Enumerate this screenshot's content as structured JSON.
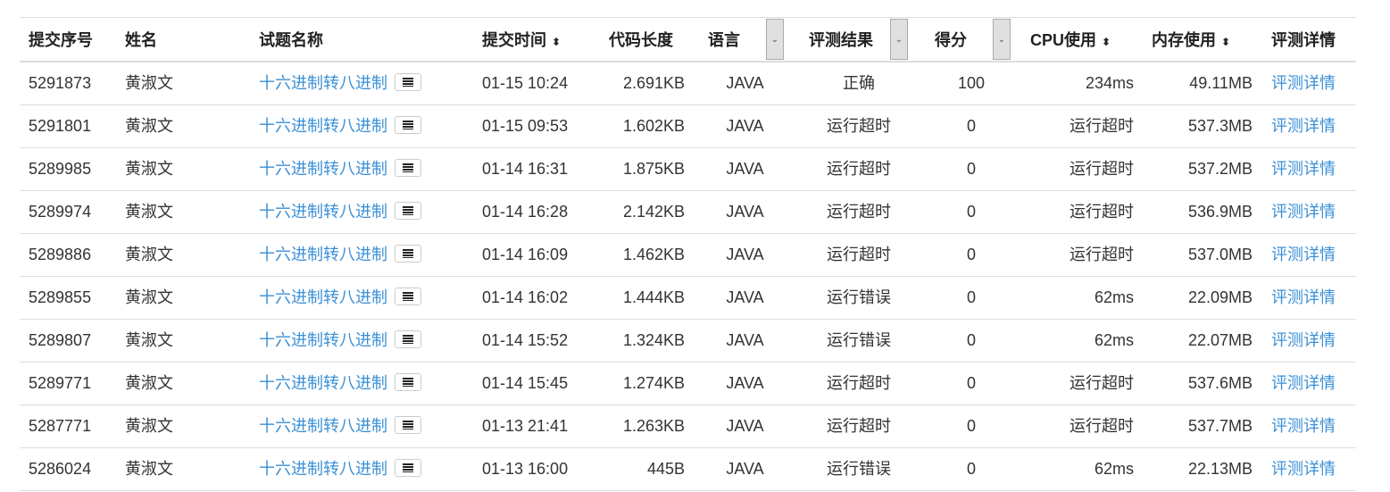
{
  "headers": {
    "id": "提交序号",
    "name": "姓名",
    "problem": "试题名称",
    "time": "提交时间",
    "length": "代码长度",
    "lang": "语言",
    "result": "评测结果",
    "score": "得分",
    "cpu": "CPU使用",
    "mem": "内存使用",
    "detail": "评测详情"
  },
  "sort_icon": "⬍",
  "dropdown_icon": "⌄",
  "rows": [
    {
      "id": "5291873",
      "name": "黄淑文",
      "problem": "十六进制转八进制",
      "time": "01-15 10:24",
      "length": "2.691KB",
      "lang": "JAVA",
      "result": "正确",
      "score": "100",
      "cpu": "234ms",
      "mem": "49.11MB",
      "detail": "评测详情"
    },
    {
      "id": "5291801",
      "name": "黄淑文",
      "problem": "十六进制转八进制",
      "time": "01-15 09:53",
      "length": "1.602KB",
      "lang": "JAVA",
      "result": "运行超时",
      "score": "0",
      "cpu": "运行超时",
      "mem": "537.3MB",
      "detail": "评测详情"
    },
    {
      "id": "5289985",
      "name": "黄淑文",
      "problem": "十六进制转八进制",
      "time": "01-14 16:31",
      "length": "1.875KB",
      "lang": "JAVA",
      "result": "运行超时",
      "score": "0",
      "cpu": "运行超时",
      "mem": "537.2MB",
      "detail": "评测详情"
    },
    {
      "id": "5289974",
      "name": "黄淑文",
      "problem": "十六进制转八进制",
      "time": "01-14 16:28",
      "length": "2.142KB",
      "lang": "JAVA",
      "result": "运行超时",
      "score": "0",
      "cpu": "运行超时",
      "mem": "536.9MB",
      "detail": "评测详情"
    },
    {
      "id": "5289886",
      "name": "黄淑文",
      "problem": "十六进制转八进制",
      "time": "01-14 16:09",
      "length": "1.462KB",
      "lang": "JAVA",
      "result": "运行超时",
      "score": "0",
      "cpu": "运行超时",
      "mem": "537.0MB",
      "detail": "评测详情"
    },
    {
      "id": "5289855",
      "name": "黄淑文",
      "problem": "十六进制转八进制",
      "time": "01-14 16:02",
      "length": "1.444KB",
      "lang": "JAVA",
      "result": "运行错误",
      "score": "0",
      "cpu": "62ms",
      "mem": "22.09MB",
      "detail": "评测详情"
    },
    {
      "id": "5289807",
      "name": "黄淑文",
      "problem": "十六进制转八进制",
      "time": "01-14 15:52",
      "length": "1.324KB",
      "lang": "JAVA",
      "result": "运行错误",
      "score": "0",
      "cpu": "62ms",
      "mem": "22.07MB",
      "detail": "评测详情"
    },
    {
      "id": "5289771",
      "name": "黄淑文",
      "problem": "十六进制转八进制",
      "time": "01-14 15:45",
      "length": "1.274KB",
      "lang": "JAVA",
      "result": "运行超时",
      "score": "0",
      "cpu": "运行超时",
      "mem": "537.6MB",
      "detail": "评测详情"
    },
    {
      "id": "5287771",
      "name": "黄淑文",
      "problem": "十六进制转八进制",
      "time": "01-13 21:41",
      "length": "1.263KB",
      "lang": "JAVA",
      "result": "运行超时",
      "score": "0",
      "cpu": "运行超时",
      "mem": "537.7MB",
      "detail": "评测详情"
    },
    {
      "id": "5286024",
      "name": "黄淑文",
      "problem": "十六进制转八进制",
      "time": "01-13 16:00",
      "length": "445B",
      "lang": "JAVA",
      "result": "运行错误",
      "score": "0",
      "cpu": "62ms",
      "mem": "22.13MB",
      "detail": "评测详情"
    }
  ]
}
